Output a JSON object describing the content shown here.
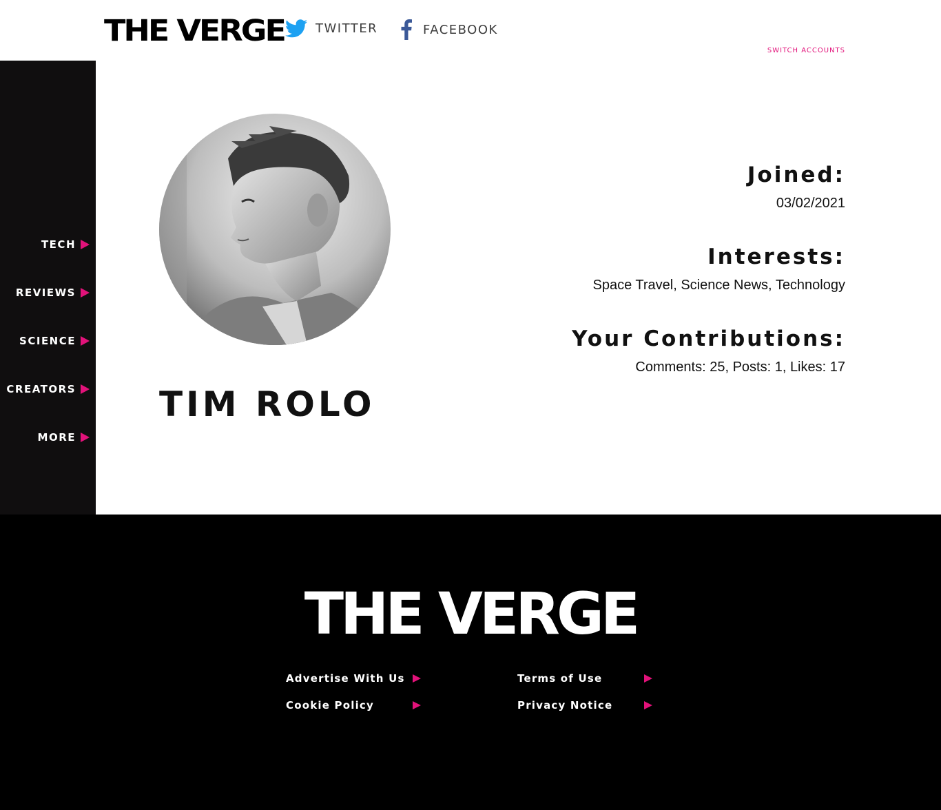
{
  "header": {
    "logo": "THE VERGE",
    "twitter_label": "TWITTER",
    "facebook_label": "FACEBOOK",
    "switch_accounts": "SWITCH ACCOUNTS"
  },
  "sidebar": {
    "items": [
      {
        "label": "TECH"
      },
      {
        "label": "REVIEWS"
      },
      {
        "label": "SCIENCE"
      },
      {
        "label": "CREATORS"
      },
      {
        "label": "MORE"
      }
    ]
  },
  "profile": {
    "name": "TIM ROLO",
    "joined_label": "Joined:",
    "joined_value": "03/02/2021",
    "interests_label": "Interests:",
    "interests_value": "Space Travel, Science News, Technology",
    "contributions_label": "Your Contributions:",
    "contributions_value": "Comments: 25, Posts: 1, Likes: 17"
  },
  "footer": {
    "logo": "THE VERGE",
    "links": [
      {
        "label": "Advertise With Us"
      },
      {
        "label": "Terms of Use"
      },
      {
        "label": "Cookie Policy"
      },
      {
        "label": "Privacy Notice"
      }
    ]
  },
  "colors": {
    "accent": "#e2127a",
    "twitter": "#1da1f2",
    "facebook": "#3b5998",
    "sidebar_bg": "#100e0f"
  }
}
